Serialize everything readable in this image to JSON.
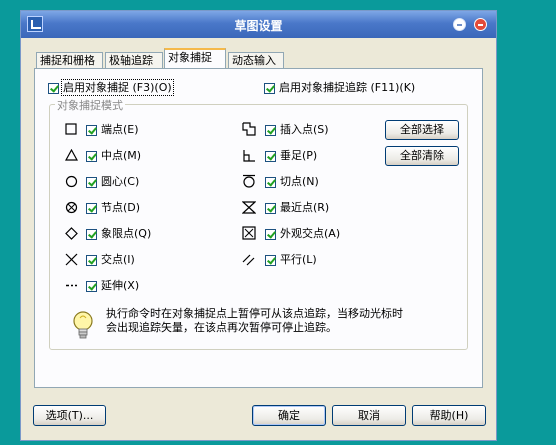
{
  "window": {
    "title": "草图设置"
  },
  "tabs": [
    {
      "label": "捕捉和栅格"
    },
    {
      "label": "极轴追踪"
    },
    {
      "label": "对象捕捉"
    },
    {
      "label": "动态输入"
    }
  ],
  "options": {
    "enable_osnap": {
      "label": "启用对象捕捉 (F3)(O)",
      "checked": true
    },
    "enable_tracking": {
      "label": "启用对象捕捉追踪 (F11)(K)",
      "checked": true
    }
  },
  "group": {
    "title": "对象捕捉模式",
    "left_modes": [
      {
        "label": "端点(E)",
        "icon": "square-endpoint-icon",
        "checked": true
      },
      {
        "label": "中点(M)",
        "icon": "triangle-midpoint-icon",
        "checked": true
      },
      {
        "label": "圆心(C)",
        "icon": "circle-center-icon",
        "checked": true
      },
      {
        "label": "节点(D)",
        "icon": "node-icon",
        "checked": true
      },
      {
        "label": "象限点(Q)",
        "icon": "diamond-quadrant-icon",
        "checked": true
      },
      {
        "label": "交点(I)",
        "icon": "cross-intersection-icon",
        "checked": true
      },
      {
        "label": "延伸(X)",
        "icon": "extension-icon",
        "checked": true
      }
    ],
    "right_modes": [
      {
        "label": "插入点(S)",
        "icon": "insert-icon",
        "checked": true
      },
      {
        "label": "垂足(P)",
        "icon": "perpendicular-icon",
        "checked": true
      },
      {
        "label": "切点(N)",
        "icon": "tangent-icon",
        "checked": true
      },
      {
        "label": "最近点(R)",
        "icon": "nearest-icon",
        "checked": true
      },
      {
        "label": "外观交点(A)",
        "icon": "apparent-intersection-icon",
        "checked": true
      },
      {
        "label": "平行(L)",
        "icon": "parallel-icon",
        "checked": true
      }
    ],
    "select_all": "全部选择",
    "clear_all": "全部清除"
  },
  "info": {
    "line1": "执行命令时在对象捕捉点上暂停可从该点追踪，当移动光标时",
    "line2": "会出现追踪矢量，在该点再次暂停可停止追踪。"
  },
  "footer": {
    "options": "选项(T)...",
    "ok": "确定",
    "cancel": "取消",
    "help": "帮助(H)"
  }
}
